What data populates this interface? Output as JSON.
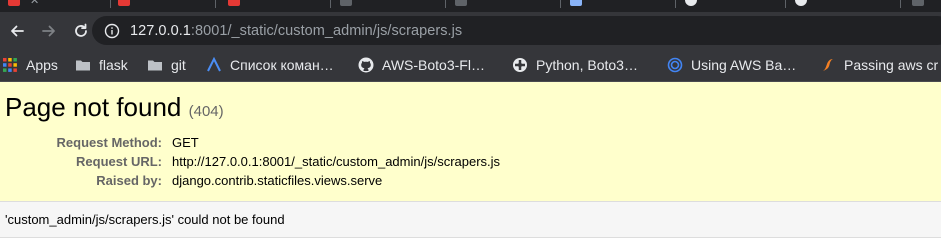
{
  "browser": {
    "url": {
      "host": "127.0.0.1",
      "rest": ":8001/_static/custom_admin/js/scrapers.js"
    },
    "bookmarks": [
      {
        "label": "Apps",
        "icon": "apps-grid-icon"
      },
      {
        "label": "flask",
        "icon": "folder-icon"
      },
      {
        "label": "git",
        "icon": "folder-icon"
      },
      {
        "label": "Список коман…",
        "icon": "site-favicon-icon"
      },
      {
        "label": "AWS-Boto3-Fl…",
        "icon": "github-icon"
      },
      {
        "label": "Python, Boto3…",
        "icon": "site-favicon-icon"
      },
      {
        "label": "Using AWS Ba…",
        "icon": "site-favicon-icon"
      },
      {
        "label": "Passing aws cr",
        "icon": "site-favicon-icon"
      }
    ],
    "colors": {
      "chrome_dark": "#202124",
      "toolbar": "#35363a",
      "text_light": "#e8eaed"
    }
  },
  "error_page": {
    "title": "Page not found",
    "status_code": "(404)",
    "meta": [
      {
        "label": "Request Method:",
        "value": "GET"
      },
      {
        "label": "Request URL:",
        "value": "http://127.0.0.1:8001/_static/custom_admin/js/scrapers.js"
      },
      {
        "label": "Raised by:",
        "value": "django.contrib.staticfiles.views.serve"
      }
    ],
    "message": "'custom_admin/js/scrapers.js' could not be found",
    "colors": {
      "summary_bg": "#ffffcc",
      "info_bg": "#f6f6f6"
    }
  }
}
